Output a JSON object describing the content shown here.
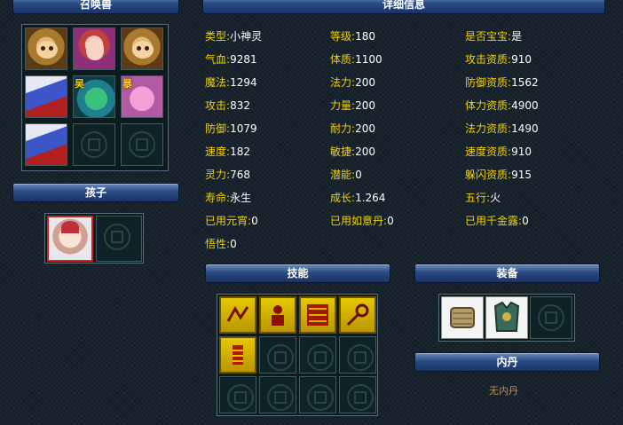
{
  "headers": {
    "summon": "召唤兽",
    "detail": "详细信息",
    "child": "孩子",
    "skill": "技能",
    "equip": "装备",
    "neidan": "内丹"
  },
  "summon_grid": [
    {
      "type": "pet",
      "icon": "monkey-pet-icon"
    },
    {
      "type": "pet",
      "icon": "girl-pet-icon"
    },
    {
      "type": "pet",
      "icon": "monkey-pet-icon"
    },
    {
      "type": "item",
      "icon": "fan-item-icon"
    },
    {
      "type": "pet",
      "icon": "dragon-pet-icon",
      "tag": "吴"
    },
    {
      "type": "pet",
      "icon": "pig-pet-icon",
      "tag": "暴"
    },
    {
      "type": "item",
      "icon": "fan-item-icon"
    },
    {
      "type": "empty",
      "icon": "empty-slot-icon"
    },
    {
      "type": "empty",
      "icon": "empty-slot-icon"
    }
  ],
  "stats": {
    "col1": [
      {
        "label": "类型",
        "value": "小神灵"
      },
      {
        "label": "气血",
        "value": "9281"
      },
      {
        "label": "魔法",
        "value": "1294"
      },
      {
        "label": "攻击",
        "value": "832"
      },
      {
        "label": "防御",
        "value": "1079"
      },
      {
        "label": "速度",
        "value": "182"
      },
      {
        "label": "灵力",
        "value": "768"
      },
      {
        "label": "寿命",
        "value": "永生"
      },
      {
        "label": "已用元宵",
        "value": "0"
      },
      {
        "label": "悟性",
        "value": "0"
      }
    ],
    "col2": [
      {
        "label": "等级",
        "value": "180"
      },
      {
        "label": "体质",
        "value": "1100"
      },
      {
        "label": "法力",
        "value": "200"
      },
      {
        "label": "力量",
        "value": "200"
      },
      {
        "label": "耐力",
        "value": "200"
      },
      {
        "label": "敏捷",
        "value": "200"
      },
      {
        "label": "潜能",
        "value": "0"
      },
      {
        "label": "成长",
        "value": "1.264"
      },
      {
        "label": "已用如意丹",
        "value": "0"
      }
    ],
    "col3": [
      {
        "label": "是否宝宝",
        "value": "是"
      },
      {
        "label": "攻击资质",
        "value": "910"
      },
      {
        "label": "防御资质",
        "value": "1562"
      },
      {
        "label": "体力资质",
        "value": "4900"
      },
      {
        "label": "法力资质",
        "value": "1490"
      },
      {
        "label": "速度资质",
        "value": "910"
      },
      {
        "label": "躲闪资质",
        "value": "915"
      },
      {
        "label": "五行",
        "value": "火"
      },
      {
        "label": "已用千金露",
        "value": "0"
      }
    ]
  },
  "neidan_text": "无内丹",
  "colors": {
    "label": "#f2d200",
    "value": "#ffffff",
    "neidan": "#d08a3a",
    "header": "#2a4a85"
  }
}
